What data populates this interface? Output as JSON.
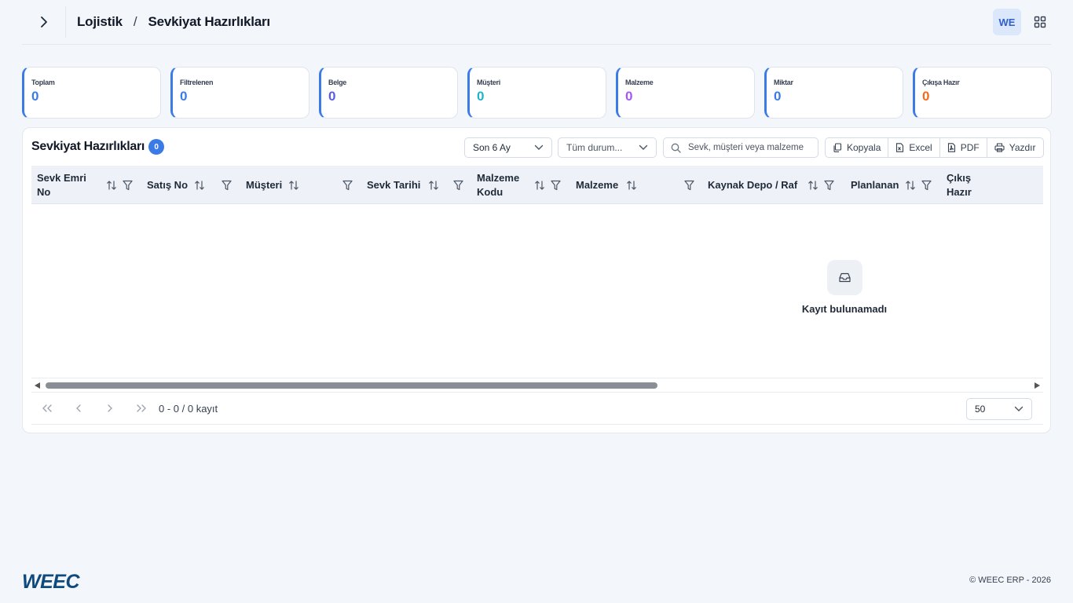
{
  "breadcrumb": {
    "parent": "Lojistik",
    "separator": "/",
    "current": "Sevkiyat Hazırlıkları"
  },
  "user": {
    "initials": "WE"
  },
  "stats": [
    {
      "label": "Toplam",
      "value": "0",
      "color": "#3b7be8"
    },
    {
      "label": "Filtrelenen",
      "value": "0",
      "color": "#3b7be8"
    },
    {
      "label": "Belge",
      "value": "0",
      "color": "#5b5ce6"
    },
    {
      "label": "Müşteri",
      "value": "0",
      "color": "#1fb5c9"
    },
    {
      "label": "Malzeme",
      "value": "0",
      "color": "#a855f7"
    },
    {
      "label": "Miktar",
      "value": "0",
      "color": "#3b7be8"
    },
    {
      "label": "Çıkışa Hazır",
      "value": "0",
      "color": "#f26b1d"
    }
  ],
  "panel": {
    "title": "Sevkiyat Hazırlıkları",
    "count": "0",
    "period_select": "Son 6 Ay",
    "status_select": "Tüm durum...",
    "search_placeholder": "Sevk, müşteri veya malzeme",
    "actions": {
      "copy": "Kopyala",
      "excel": "Excel",
      "pdf": "PDF",
      "print": "Yazdır"
    }
  },
  "table": {
    "columns": [
      {
        "label1": "Sevk Emri",
        "label2": "No"
      },
      {
        "label1": "Satış No",
        "label2": ""
      },
      {
        "label1": "Müşteri",
        "label2": ""
      },
      {
        "label1": "Sevk Tarihi",
        "label2": ""
      },
      {
        "label1": "Malzeme",
        "label2": "Kodu"
      },
      {
        "label1": "Malzeme",
        "label2": ""
      },
      {
        "label1": "Kaynak Depo / Raf",
        "label2": ""
      },
      {
        "label1": "Planlanan",
        "label2": ""
      },
      {
        "label1": "Çıkış",
        "label2": "Hazır"
      }
    ],
    "empty_text": "Kayıt bulunamadı"
  },
  "pagination": {
    "info": "0 - 0 / 0 kayıt",
    "page_size": "50"
  },
  "footer": {
    "logo_text": "WEEC",
    "copyright": "© WEEC ERP - 2026"
  }
}
